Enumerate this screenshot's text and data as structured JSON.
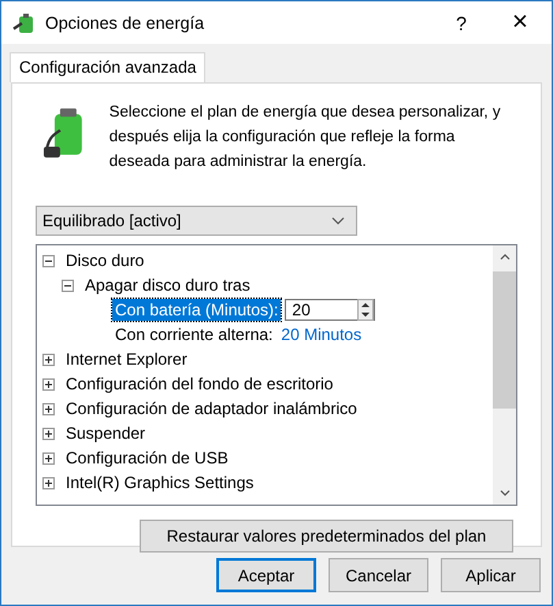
{
  "window": {
    "title": "Opciones de energía",
    "help": "?",
    "close": "×"
  },
  "tabs": [
    {
      "label": "Configuración avanzada",
      "selected": true
    }
  ],
  "description": "Seleccione el plan de energía que desea personalizar, y después elija la configuración que refleje la forma deseada para administrar la energía.",
  "plan_dropdown": {
    "value": "Equilibrado [activo]"
  },
  "tree": [
    {
      "label": "Disco duro",
      "expanded": true,
      "children": [
        {
          "label": "Apagar disco duro tras",
          "expanded": true,
          "children": [
            {
              "kind": "spin",
              "label": "Con batería (Minutos):",
              "value": "20",
              "selected": true
            },
            {
              "kind": "link",
              "label": "Con corriente alterna:",
              "value": "20 Minutos",
              "selected": false
            }
          ]
        }
      ]
    },
    {
      "label": "Internet Explorer",
      "expanded": false
    },
    {
      "label": "Configuración del fondo de escritorio",
      "expanded": false
    },
    {
      "label": "Configuración de adaptador inalámbrico",
      "expanded": false
    },
    {
      "label": "Suspender",
      "expanded": false
    },
    {
      "label": "Configuración de USB",
      "expanded": false
    },
    {
      "label": "Intel(R) Graphics Settings",
      "expanded": false
    }
  ],
  "restore_button": "Restaurar valores predeterminados del plan",
  "buttons": [
    {
      "label": "Aceptar",
      "default": true
    },
    {
      "label": "Cancelar",
      "default": false
    },
    {
      "label": "Aplicar",
      "default": false
    }
  ]
}
